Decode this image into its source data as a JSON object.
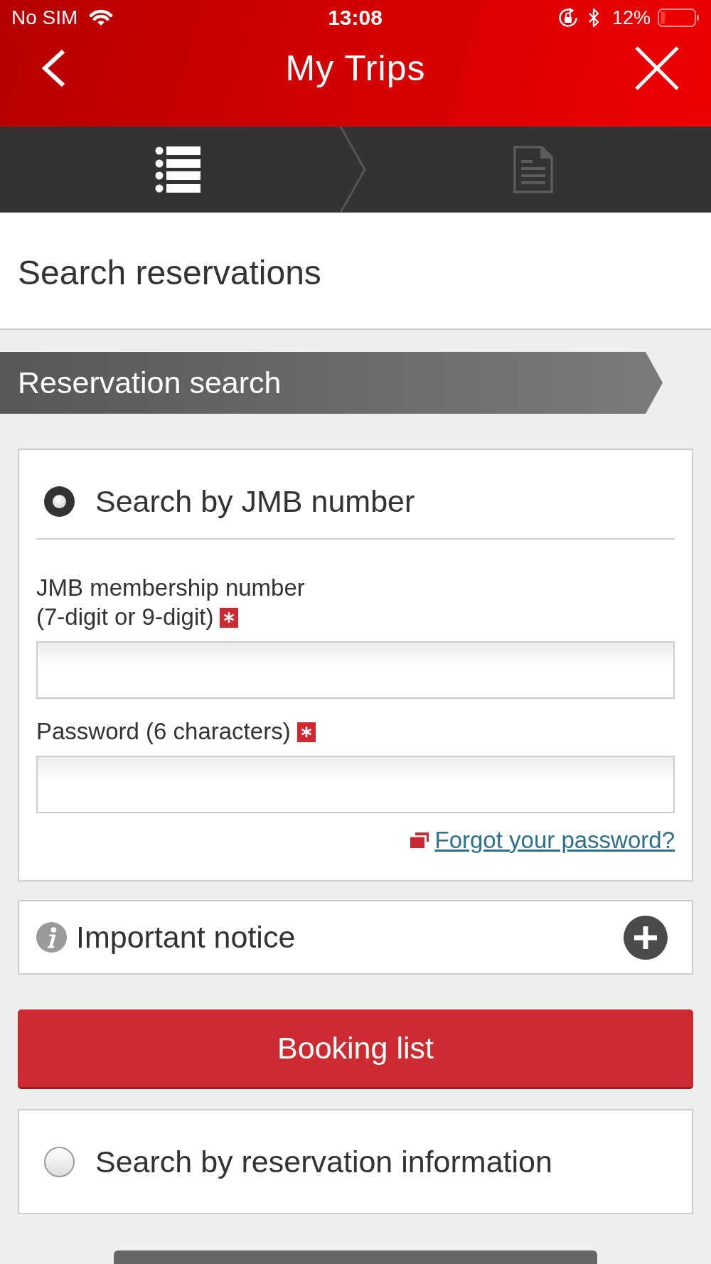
{
  "status_bar": {
    "carrier": "No SIM",
    "time": "13:08",
    "battery": "12%"
  },
  "header": {
    "title": "My Trips"
  },
  "steps": [
    {
      "kind": "list",
      "current": true
    },
    {
      "kind": "document",
      "current": false
    }
  ],
  "page_title": "Search reservations",
  "section_title": "Reservation search",
  "search_options": [
    {
      "label": "Search by JMB number",
      "selected": true,
      "fields": [
        {
          "label": "JMB membership number\n(7-digit or 9-digit)",
          "required": true
        },
        {
          "label": "Password (6 characters)",
          "required": true
        }
      ],
      "link": "Forgot your password?",
      "notice": {
        "title": "Important notice",
        "expanded": false
      },
      "button": "Booking list"
    },
    {
      "label": "Search by reservation information",
      "selected": false
    }
  ]
}
